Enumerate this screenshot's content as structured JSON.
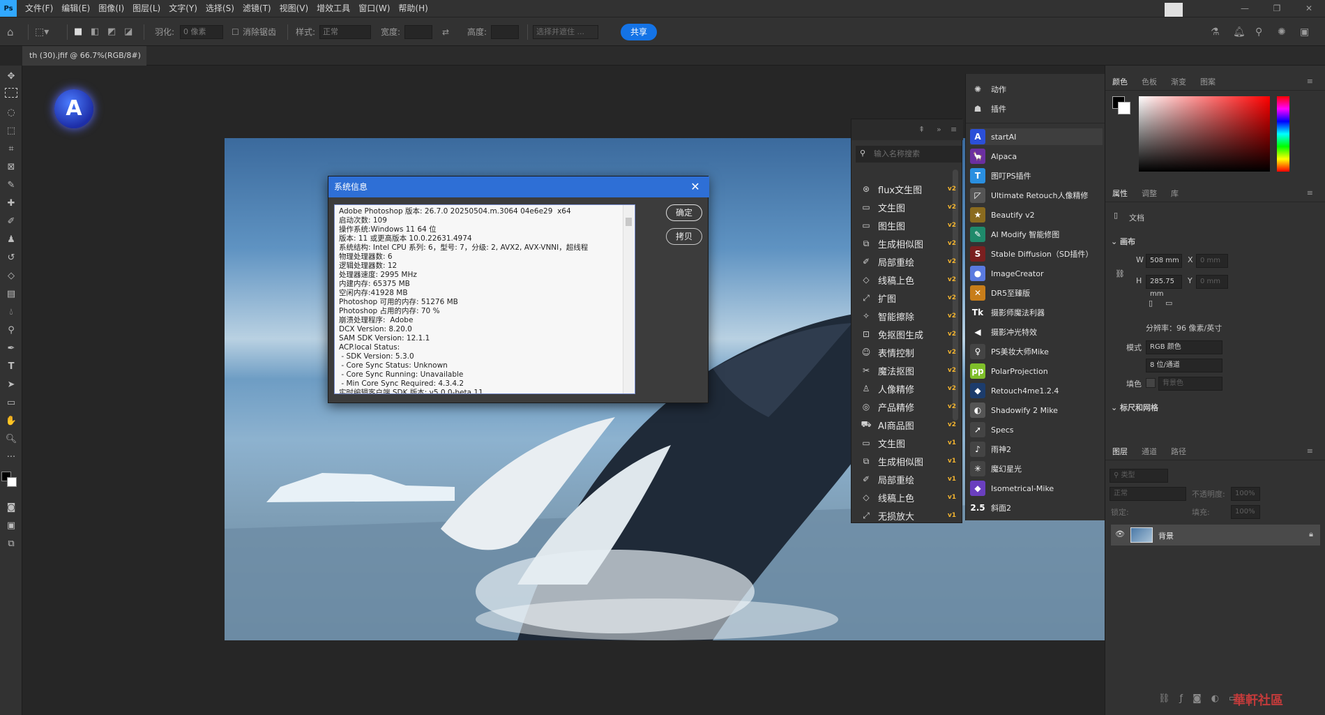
{
  "app": {
    "logo": "Ps"
  },
  "menu": [
    "文件(F)",
    "编辑(E)",
    "图像(I)",
    "图层(L)",
    "文字(Y)",
    "选择(S)",
    "滤镜(T)",
    "视图(V)",
    "增效工具",
    "窗口(W)",
    "帮助(H)"
  ],
  "window_buttons": [
    "—",
    "❐",
    "✕"
  ],
  "options": {
    "feather_label": "羽化:",
    "feather_value": "0 像素",
    "antialias_label": "消除锯齿",
    "style_label": "样式:",
    "style_value": "正常",
    "width_label": "宽度:",
    "height_label": "高度:",
    "select_mask": "选择并遮住 ...",
    "share": "共享"
  },
  "doc_tab": {
    "title": "th (30).jfif @ 66.7%(RGB/8#)",
    "close": "×"
  },
  "dialog": {
    "title": "系统信息",
    "close": "✕",
    "ok": "确定",
    "copy": "拷贝",
    "lines": [
      "Adobe Photoshop 版本: 26.7.0 20250504.m.3064 04e6e29  x64",
      "启动次数: 109",
      "操作系统:Windows 11 64 位",
      "版本: 11 或更高版本 10.0.22631.4974",
      "系统结构: Intel CPU 系列: 6，型号: 7，分级: 2, AVX2, AVX-VNNI，超线程",
      "物理处理器数: 6",
      "逻辑处理器数: 12",
      "处理器速度: 2995 MHz",
      "内建内存: 65375 MB",
      "空闲内存:41928 MB",
      "Photoshop 可用的内存: 51276 MB",
      "Photoshop 占用的内存: 70 %",
      "崩溃处理程序:  Adobe",
      "DCX Version: 8.20.0",
      "SAM SDK Version: 12.1.1",
      "ACP.local Status:",
      " - SDK Version: 5.3.0",
      " - Core Sync Status: Unknown",
      " - Core Sync Running: Unavailable",
      " - Min Core Sync Required: 4.3.4.2",
      "实时编辑客户端 SDK 版本: v5.0.0-beta.11"
    ]
  },
  "plugin_panel": {
    "search_placeholder": "输入名称搜索",
    "items": [
      {
        "label": "flux文生图",
        "ver": "v2",
        "icon": "⊛"
      },
      {
        "label": "文生图",
        "ver": "v2",
        "icon": "▭"
      },
      {
        "label": "图生图",
        "ver": "v2",
        "icon": "▭"
      },
      {
        "label": "生成相似图",
        "ver": "v2",
        "icon": "⧉"
      },
      {
        "label": "局部重绘",
        "ver": "v2",
        "icon": "✐"
      },
      {
        "label": "线稿上色",
        "ver": "v2",
        "icon": "◇"
      },
      {
        "label": "扩图",
        "ver": "v2",
        "icon": "⤢"
      },
      {
        "label": "智能擦除",
        "ver": "v2",
        "icon": "✧"
      },
      {
        "label": "免抠图生成",
        "ver": "v2",
        "icon": "⊡"
      },
      {
        "label": "表情控制",
        "ver": "v2",
        "icon": "☺"
      },
      {
        "label": "魔法抠图",
        "ver": "v2",
        "icon": "✂"
      },
      {
        "label": "人像精修",
        "ver": "v2",
        "icon": "♙"
      },
      {
        "label": "产品精修",
        "ver": "v2",
        "icon": "◎"
      },
      {
        "label": "AI商品图",
        "ver": "v2",
        "icon": "⛟"
      },
      {
        "label": "文生图",
        "ver": "v1",
        "icon": "▭"
      },
      {
        "label": "生成相似图",
        "ver": "v1",
        "icon": "⧉"
      },
      {
        "label": "局部重绘",
        "ver": "v1",
        "icon": "✐"
      },
      {
        "label": "线稿上色",
        "ver": "v1",
        "icon": "◇"
      },
      {
        "label": "无损放大",
        "ver": "v1",
        "icon": "⤢"
      }
    ]
  },
  "plugin_list": {
    "top": [
      {
        "label": "动作",
        "icon": "✺"
      },
      {
        "label": "插件",
        "icon": "☗"
      }
    ],
    "items": [
      {
        "label": "startAI",
        "icon": "A",
        "color": "#2b4fd8"
      },
      {
        "label": "Alpaca",
        "icon": "🦙",
        "color": "#6b2fa0"
      },
      {
        "label": "图叮PS插件",
        "icon": "T",
        "color": "#2a8fe0"
      },
      {
        "label": "Ultimate Retouch人像精修",
        "icon": "◸",
        "color": "#555555"
      },
      {
        "label": "Beautify v2",
        "icon": "★",
        "color": "#8a6b1f"
      },
      {
        "label": "AI Modify 智能修图",
        "icon": "✎",
        "color": "#1f8a6b"
      },
      {
        "label": "Stable Diffusion（SD插件）",
        "icon": "S",
        "color": "#7a2020"
      },
      {
        "label": "ImageCreator",
        "icon": "●",
        "color": "#5a7adf"
      },
      {
        "label": "DR5至臻版",
        "icon": "✕",
        "color": "#c77d1a"
      },
      {
        "label": "摄影师魔法利器",
        "icon": "Tk",
        "color": "#333333"
      },
      {
        "label": "摄影冲光特效",
        "icon": "◀",
        "color": "#333333"
      },
      {
        "label": "PS美妆大师Mike",
        "icon": "♀",
        "color": "#444444"
      },
      {
        "label": "PolarProjection",
        "icon": "pp",
        "color": "#7fbf2a"
      },
      {
        "label": "Retouch4me1.2.4",
        "icon": "◆",
        "color": "#1c3c6c"
      },
      {
        "label": "Shadowify 2 Mike",
        "icon": "◐",
        "color": "#555555"
      },
      {
        "label": "Specs",
        "icon": "➚",
        "color": "#444444"
      },
      {
        "label": "雨神2",
        "icon": "♪",
        "color": "#444444"
      },
      {
        "label": "魔幻星光",
        "icon": "✳",
        "color": "#444444"
      },
      {
        "label": "Isometrical-Mike",
        "icon": "◆",
        "color": "#6a3fbf"
      },
      {
        "label": "斜面2",
        "icon": "2.5",
        "color": "#333333"
      }
    ]
  },
  "color_panel": {
    "tabs": [
      "颜色",
      "色板",
      "渐变",
      "图案"
    ]
  },
  "properties_panel": {
    "tabs": [
      "属性",
      "调整",
      "库"
    ],
    "doc_label": "文档",
    "canvas_section": "画布",
    "w_label": "W",
    "w_value": "508 mm",
    "h_label": "H",
    "h_value": "285.75 mm",
    "x_label": "X",
    "x_value": "0 mm",
    "y_label": "Y",
    "y_value": "0 mm",
    "resolution": "分辨率：96 像素/英寸",
    "mode_label": "模式",
    "mode_value": "RGB 颜色",
    "depth_value": "8 位/通道",
    "fill_label": "填色",
    "fill_value": "背景色",
    "rulers_section": "标尺和网格"
  },
  "layers_panel": {
    "tabs": [
      "图层",
      "通道",
      "路径"
    ],
    "filter_label": "类型",
    "blend_mode": "正常",
    "opacity_label": "不透明度:",
    "opacity_value": "100%",
    "lock_label": "锁定:",
    "fill_label": "填充:",
    "fill_value": "100%",
    "layer_name": "背景"
  },
  "watermark": "華軒社區"
}
